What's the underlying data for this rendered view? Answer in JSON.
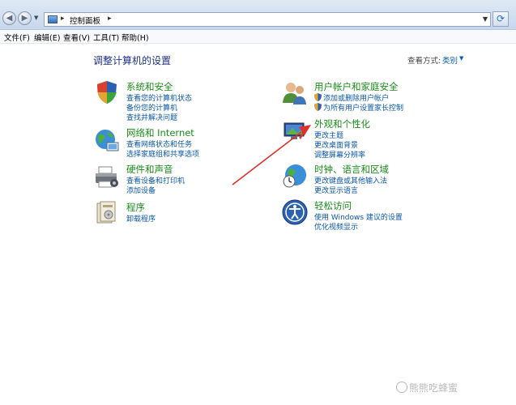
{
  "address_bar": {
    "path": "控制面板"
  },
  "menu": {
    "items": [
      "文件(F)",
      "编辑(E)",
      "查看(V)",
      "工具(T)",
      "帮助(H)"
    ]
  },
  "main": {
    "heading": "调整计算机的设置",
    "view_by_label": "查看方式:",
    "view_by_value": "类别"
  },
  "categories": {
    "system_security": {
      "title": "系统和安全",
      "links": [
        "查看您的计算机状态",
        "备份您的计算机",
        "查找并解决问题"
      ]
    },
    "network": {
      "title": "网络和 Internet",
      "links": [
        "查看网络状态和任务",
        "选择家庭组和共享选项"
      ]
    },
    "hardware": {
      "title": "硬件和声音",
      "links": [
        "查看设备和打印机",
        "添加设备"
      ]
    },
    "programs": {
      "title": "程序",
      "links": [
        "卸载程序"
      ]
    },
    "user_accounts": {
      "title": "用户帐户和家庭安全",
      "links": [
        "添加或删除用户帐户",
        "为所有用户设置家长控制"
      ]
    },
    "appearance": {
      "title": "外观和个性化",
      "links": [
        "更改主题",
        "更改桌面背景",
        "调整屏幕分辨率"
      ]
    },
    "clock_region": {
      "title": "时钟、语言和区域",
      "links": [
        "更改键盘或其他输入法",
        "更改显示语言"
      ]
    },
    "ease_access": {
      "title": "轻松访问",
      "links": [
        "使用 Windows 建议的设置",
        "优化视频显示"
      ]
    }
  },
  "annotation": {
    "color": "#e0302a"
  },
  "watermark": {
    "text": "熊熊吃蜂蜜"
  },
  "colors": {
    "title_green": "#1a8c1a",
    "link_blue": "#0b57a7",
    "heading_blue": "#1e3287"
  }
}
